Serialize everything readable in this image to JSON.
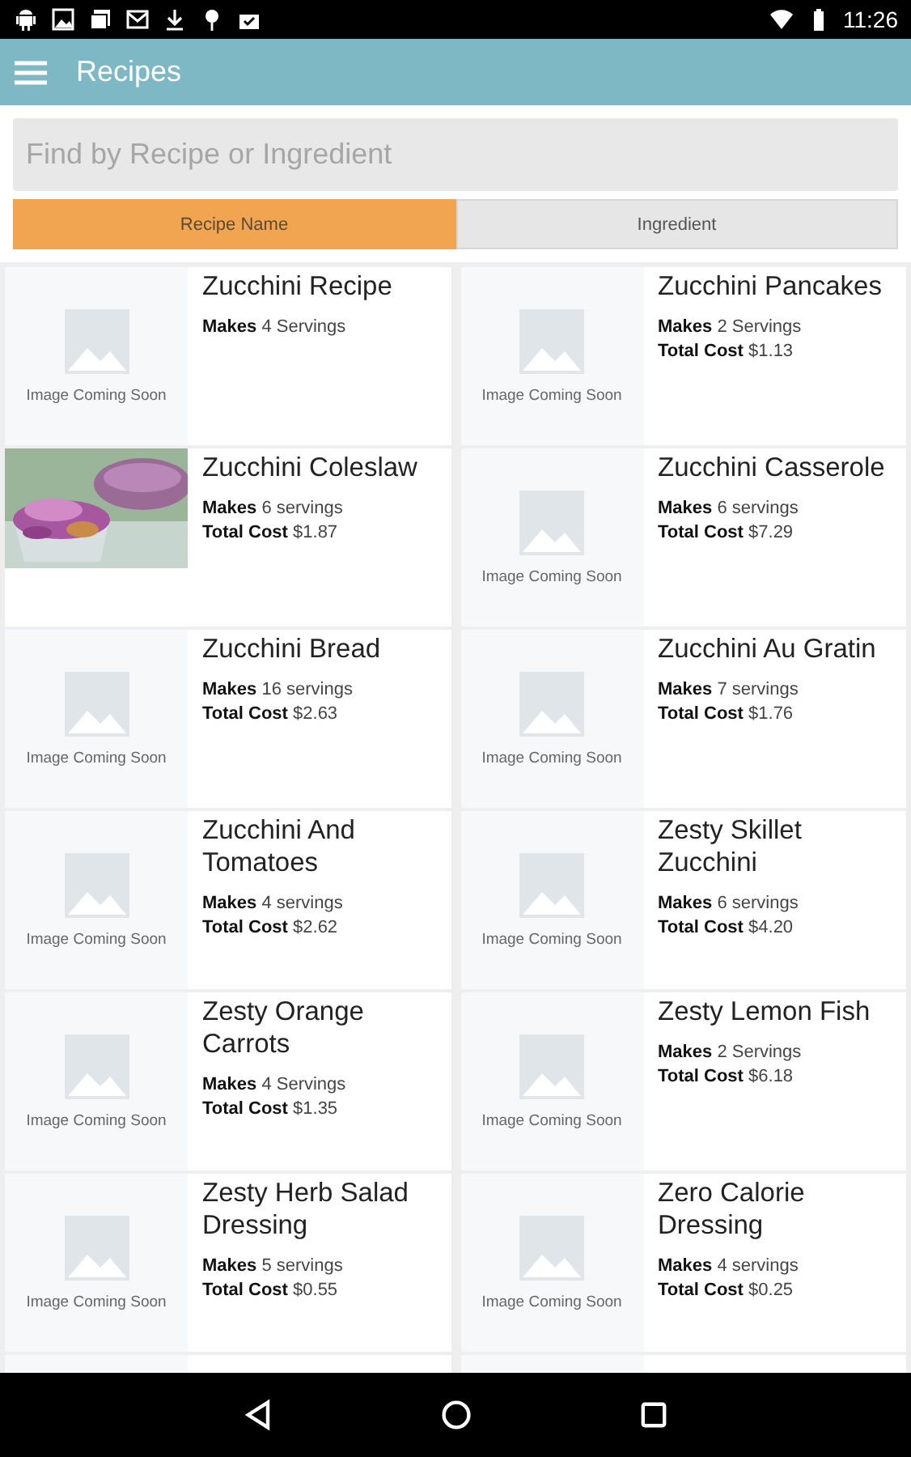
{
  "status_bar": {
    "time": "11:26"
  },
  "app_bar": {
    "title": "Recipes"
  },
  "search": {
    "placeholder": "Find by Recipe or Ingredient"
  },
  "tabs": [
    {
      "label": "Recipe Name",
      "selected": true
    },
    {
      "label": "Ingredient",
      "selected": false
    }
  ],
  "recipes": [
    {
      "name": "Zucchini Recipe",
      "kind": "placeholder",
      "image_text": "Image Coming Soon",
      "makes_label": "Makes",
      "makes": "4 Servings"
    },
    {
      "name": "Zucchini Pancakes",
      "kind": "placeholder",
      "image_text": "Image Coming Soon",
      "makes_label": "Makes",
      "makes": "2 Servings",
      "cost_label": "Total Cost",
      "cost": "$1.13"
    },
    {
      "name": "Zucchini Coleslaw",
      "kind": "picture",
      "makes_label": "Makes",
      "makes": "6 servings",
      "cost_label": "Total Cost",
      "cost": "$1.87"
    },
    {
      "name": "Zucchini Casserole",
      "kind": "placeholder",
      "image_text": "Image Coming Soon",
      "makes_label": "Makes",
      "makes": "6 servings",
      "cost_label": "Total Cost",
      "cost": "$7.29"
    },
    {
      "name": "Zucchini Bread",
      "kind": "placeholder",
      "image_text": "Image Coming Soon",
      "makes_label": "Makes",
      "makes": "16 servings",
      "cost_label": "Total Cost",
      "cost": "$2.63"
    },
    {
      "name": "Zucchini Au Gratin",
      "kind": "placeholder",
      "image_text": "Image Coming Soon",
      "makes_label": "Makes",
      "makes": "7 servings",
      "cost_label": "Total Cost",
      "cost": "$1.76"
    },
    {
      "name": "Zucchini And Tomatoes",
      "kind": "placeholder",
      "image_text": "Image Coming Soon",
      "makes_label": "Makes",
      "makes": "4 servings",
      "cost_label": "Total Cost",
      "cost": "$2.62"
    },
    {
      "name": "Zesty Skillet Zucchini",
      "kind": "placeholder",
      "image_text": "Image Coming Soon",
      "makes_label": "Makes",
      "makes": "6 servings",
      "cost_label": "Total Cost",
      "cost": "$4.20"
    },
    {
      "name": "Zesty Orange Carrots",
      "kind": "placeholder",
      "image_text": "Image Coming Soon",
      "makes_label": "Makes",
      "makes": "4 Servings",
      "cost_label": "Total Cost",
      "cost": "$1.35"
    },
    {
      "name": "Zesty Lemon Fish",
      "kind": "placeholder",
      "image_text": "Image Coming Soon",
      "makes_label": "Makes",
      "makes": "2 Servings",
      "cost_label": "Total Cost",
      "cost": "$6.18"
    },
    {
      "name": "Zesty Herb Salad Dressing",
      "kind": "placeholder",
      "image_text": "Image Coming Soon",
      "makes_label": "Makes",
      "makes": "5 servings",
      "cost_label": "Total Cost",
      "cost": "$0.55"
    },
    {
      "name": "Zero Calorie Dressing",
      "kind": "placeholder",
      "image_text": "Image Coming Soon",
      "makes_label": "Makes",
      "makes": "4 servings",
      "cost_label": "Total Cost",
      "cost": "$0.25"
    },
    {
      "kind": "placeholder"
    },
    {
      "kind": "placeholder"
    }
  ]
}
